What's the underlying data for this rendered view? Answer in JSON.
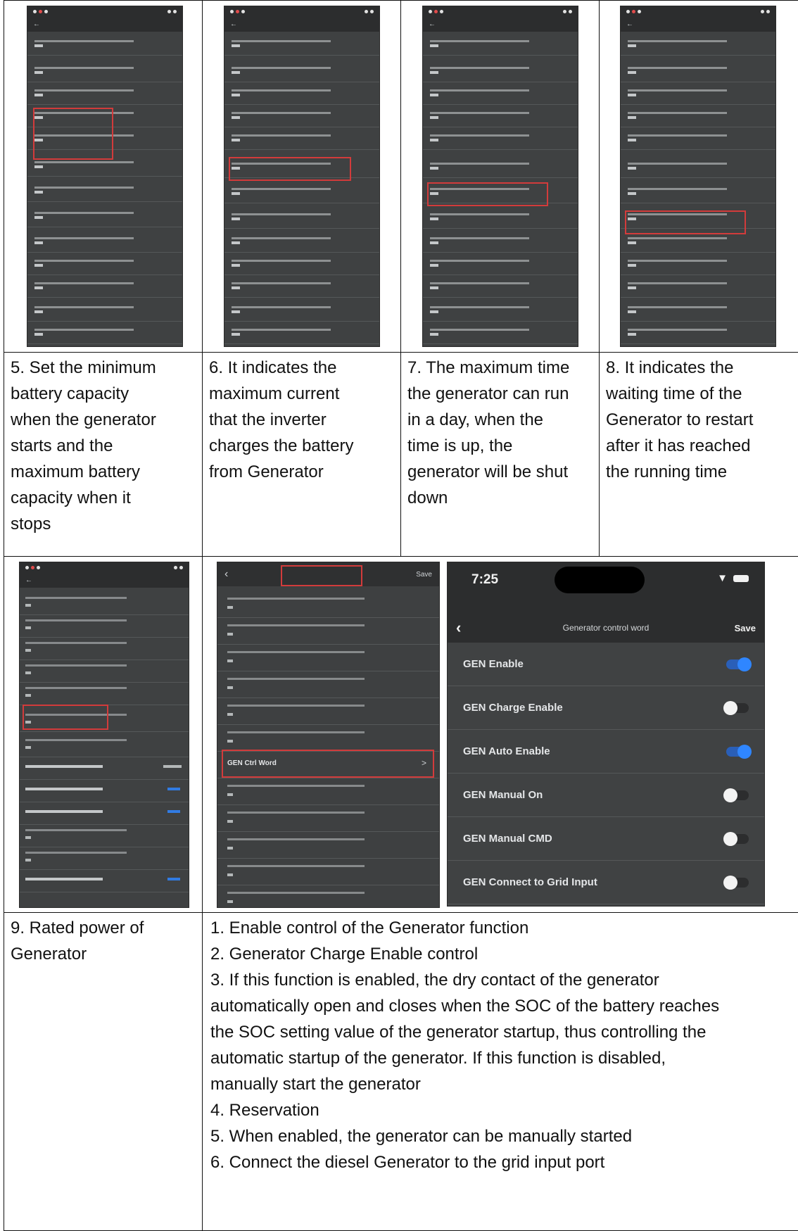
{
  "row1_captions": [
    {
      "lines": [
        "5. Set the minimum",
        "battery capacity",
        "when the generator",
        "starts and the",
        "maximum battery",
        "capacity when it",
        "stops"
      ]
    },
    {
      "lines": [
        "6. It indicates the",
        "maximum current",
        "that the inverter",
        "charges the battery",
        "from Generator"
      ]
    },
    {
      "lines": [
        "7. The maximum time",
        "the generator can run",
        "in a day, when the",
        "time is up, the",
        "generator will be shut",
        "down"
      ]
    },
    {
      "lines": [
        "8. It indicates the",
        "waiting time of the",
        "Generator to restart",
        "after it has reached",
        "the running time"
      ]
    }
  ],
  "row2": {
    "mid_phone": {
      "header_save": "Save",
      "ctrl_word_label": "GEN Ctrl Word",
      "ctrl_word_chevron": ">"
    },
    "gen_phone": {
      "time": "7:25",
      "title": "Generator control word",
      "save_label": "Save",
      "toggles": [
        {
          "label": "GEN Enable",
          "state": "on"
        },
        {
          "label": "GEN Charge Enable",
          "state": "off"
        },
        {
          "label": "GEN Auto Enable",
          "state": "on"
        },
        {
          "label": "GEN Manual On",
          "state": "off"
        },
        {
          "label": "GEN Manual CMD",
          "state": "off"
        },
        {
          "label": "GEN Connect to Grid Input",
          "state": "off"
        }
      ]
    }
  },
  "row3": {
    "left_lines": [
      "9. Rated power of",
      "Generator"
    ],
    "right_lines": [
      "1. Enable control of the Generator function",
      "2. Generator Charge Enable control",
      "3. If this function is enabled, the dry contact of the generator",
      "automatically open and closes when the SOC of the battery reaches",
      "the SOC setting value of the generator startup, thus controlling the",
      "automatic startup of the generator. If this function is disabled,",
      "manually start the generator",
      "4. Reservation",
      "5. When enabled, the generator can be manually started",
      "6. Connect the diesel Generator to the grid input port"
    ]
  },
  "colors": {
    "red_box": "#d23b3b",
    "toggle_on": "#2f86ff",
    "phone_bg": "#3f4142"
  }
}
